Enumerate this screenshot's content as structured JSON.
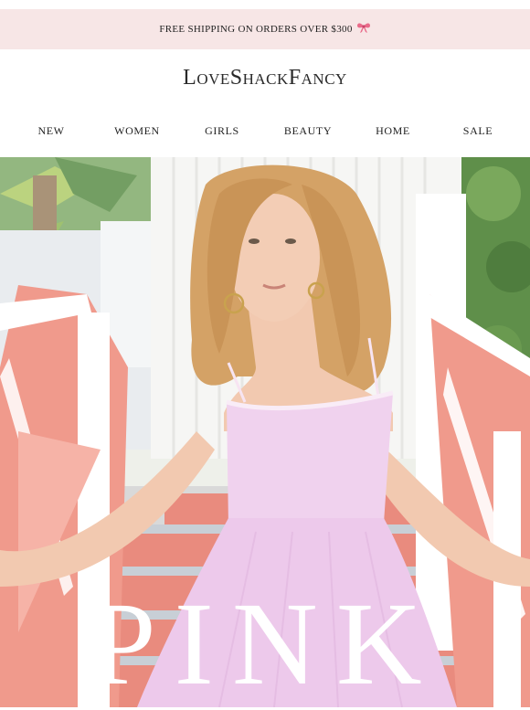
{
  "promo": {
    "text": "FREE SHIPPING ON ORDERS OVER $300",
    "icon": "bow-icon"
  },
  "brand": {
    "logo": "LoveShackFancy"
  },
  "nav": {
    "items": [
      "NEW",
      "WOMEN",
      "GIRLS",
      "BEAUTY",
      "HOME",
      "SALE"
    ]
  },
  "hero": {
    "title": "PINK"
  },
  "colors": {
    "promo_bg": "#f7e6e6",
    "dress": "#f0d2ee",
    "stairs": "#e98b7e"
  }
}
